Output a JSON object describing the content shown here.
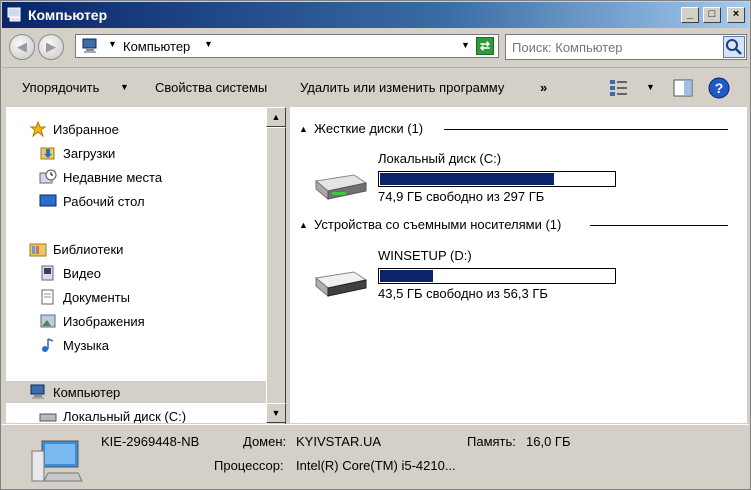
{
  "window": {
    "title": "Компьютер"
  },
  "window_buttons": {
    "minimize": "_",
    "maximize": "□",
    "close": "×"
  },
  "address": {
    "location": "Компьютер"
  },
  "search": {
    "placeholder": "Поиск: Компьютер"
  },
  "toolbar": {
    "organize": "Упорядочить",
    "system_properties": "Свойства системы",
    "uninstall": "Удалить или изменить программу",
    "more": "»"
  },
  "nav": {
    "favorites": "Избранное",
    "downloads": "Загрузки",
    "recent": "Недавние места",
    "desktop": "Рабочий стол",
    "libraries": "Библиотеки",
    "video": "Видео",
    "documents": "Документы",
    "images": "Изображения",
    "music": "Музыка",
    "computer": "Компьютер",
    "local_disk": "Локальный диск (C:)"
  },
  "groups": {
    "hard_disks": "Жесткие диски (1)",
    "removable": "Устройства со съемными носителями (1)"
  },
  "drives": [
    {
      "name": "Локальный диск (C:)",
      "free_text": "74,9 ГБ свободно из 297 ГБ",
      "used_fraction": 0.75
    },
    {
      "name": "WINSETUP (D:)",
      "free_text": "43,5 ГБ свободно из 56,3 ГБ",
      "used_fraction": 0.23
    }
  ],
  "details": {
    "computer_name": "KIE-2969448-NB",
    "domain_label": "Домен:",
    "domain_value": "KYIVSTAR.UA",
    "memory_label": "Память:",
    "memory_value": "16,0 ГБ",
    "cpu_label": "Процессор:",
    "cpu_value": "Intel(R) Core(TM) i5-4210..."
  },
  "colors": {
    "bar_fill": "#0a246a",
    "title_bar": "#0a246a"
  }
}
